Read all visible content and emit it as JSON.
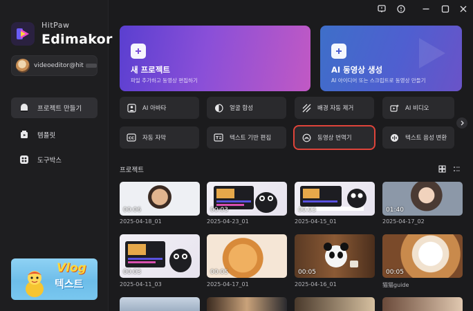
{
  "brand": {
    "sub": "HitPaw",
    "main": "Edimakor"
  },
  "account": {
    "email": "videoeditor@hitpa..."
  },
  "nav": [
    {
      "label": "프로젝트 만들기",
      "active": true
    },
    {
      "label": "템플릿",
      "active": false
    },
    {
      "label": "도구박스",
      "active": false
    }
  ],
  "promo": {
    "title": "Vlog",
    "subtitle": "텍스트"
  },
  "cards": [
    {
      "title": "새 프로젝트",
      "subtitle": "파일 추가하고 동영상 편집하기"
    },
    {
      "title": "AI 동영상 생성",
      "subtitle": "AI 아이디어 또는 스크립트로 동영상 만들기"
    }
  ],
  "features": [
    {
      "label": "AI 아바타",
      "icon": "avatar-icon"
    },
    {
      "label": "얼굴 합성",
      "icon": "face-swap-icon"
    },
    {
      "label": "배경 자동 제거",
      "icon": "background-remove-icon"
    },
    {
      "label": "AI 비디오",
      "icon": "ai-video-icon"
    },
    {
      "label": "자동 자막",
      "icon": "caption-icon"
    },
    {
      "label": "텍스트 기반 편집",
      "icon": "text-edit-icon"
    },
    {
      "label": "동영상 번역기",
      "icon": "translate-icon",
      "highlighted": true
    },
    {
      "label": "텍스트 음성 변환",
      "icon": "tts-icon"
    }
  ],
  "projects_section": {
    "title": "프로젝트"
  },
  "projects": [
    {
      "duration": "00:06",
      "name": "2025-04-18_01"
    },
    {
      "duration": "00:03",
      "name": "2025-04-23_01"
    },
    {
      "duration": "00:03",
      "name": "2025-04-15_01"
    },
    {
      "duration": "01:40",
      "name": "2025-04-17_02"
    },
    {
      "duration": "00:03",
      "name": "2025-04-11_03"
    },
    {
      "duration": "00:05",
      "name": "2025-04-17_01"
    },
    {
      "duration": "00:05",
      "name": "2025-04-16_01"
    },
    {
      "duration": "00:05",
      "name": "猫猫guide"
    }
  ],
  "colors": {
    "highlight": "#e0443a",
    "accent": "#7b4fd8"
  }
}
